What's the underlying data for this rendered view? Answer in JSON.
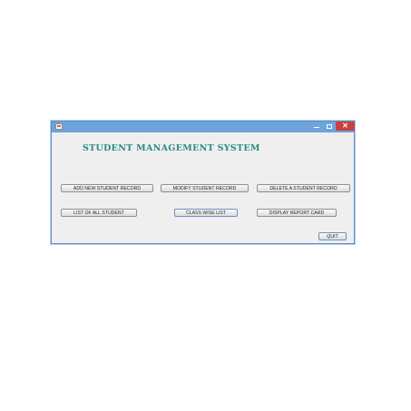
{
  "window": {
    "controls": {
      "minimize": "minimize",
      "maximize": "maximize",
      "close": "close"
    }
  },
  "main": {
    "title": "STUDENT MANAGEMENT SYSTEM",
    "buttons": {
      "add": "ADD NEW STUDENT RECORD",
      "modify": "MODIFY STUDENT RECORD",
      "delete": "DELETE A STUDENT RECORD",
      "list": "LIST OF ALL STUDENT",
      "class_wise": "CLASS WISE LIST",
      "report": "DISPLAY REPORT CARD",
      "quit": "QUIT"
    }
  },
  "colors": {
    "title_text": "#2a8a84",
    "titlebar": "#6ea3dc",
    "close_button": "#c94040",
    "window_background": "#efefef"
  },
  "icons": {
    "app": "java-app-icon",
    "minimize": "minimize-icon",
    "maximize": "maximize-icon",
    "close": "close-icon"
  }
}
